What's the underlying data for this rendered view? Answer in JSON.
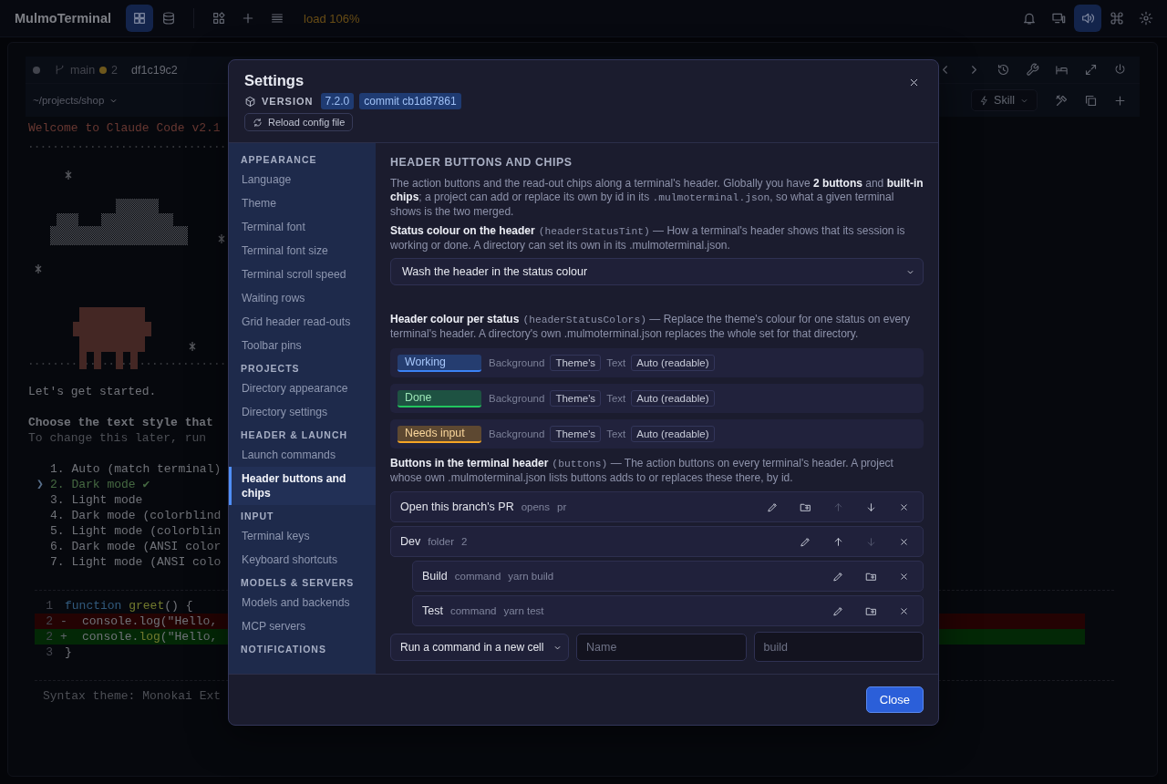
{
  "app": {
    "title": "MulmoTerminal",
    "load": "load 106%",
    "left_tools": [
      {
        "selected": true
      },
      {
        "selected": false
      },
      {
        "selected": false
      },
      {
        "selected": false
      },
      {
        "selected": false
      }
    ],
    "right_tools": [
      {
        "selected": false
      },
      {
        "selected": false
      },
      {
        "selected": true
      },
      {
        "selected": false
      },
      {
        "selected": false
      }
    ]
  },
  "terminal": {
    "branch": "main",
    "changes": "2",
    "commit": "df1c19c2",
    "path": "~/projects/shop",
    "skill": "Skill",
    "welcome": "Welcome to Claude Code v2.1",
    "intro": "Let's get started.",
    "prompt": "Choose the text style that",
    "hint": "To change this later, run",
    "theme_menu": {
      "pointer": "❯",
      "options": [
        {
          "label": "1. Auto (match terminal)",
          "selected": false
        },
        {
          "label": "2. Dark mode ✔",
          "selected": true
        },
        {
          "label": "3. Light mode",
          "selected": false
        },
        {
          "label": "4. Dark mode (colorblind",
          "selected": false
        },
        {
          "label": "5. Light mode (colorblin",
          "selected": false
        },
        {
          "label": "6. Dark mode (ANSI color",
          "selected": false
        },
        {
          "label": "7. Light mode (ANSI colo",
          "selected": false
        }
      ]
    },
    "diff": [
      {
        "kind": "context",
        "number": "1",
        "tokens": [
          {
            "kind": "keyword",
            "text": "function "
          },
          {
            "kind": "function",
            "text": "greet"
          },
          {
            "kind": "plain",
            "text": "() {"
          }
        ]
      },
      {
        "kind": "removed",
        "number": "2",
        "sign": "-",
        "tokens": [
          {
            "kind": "plain",
            "text": "console.log(\"Hello,"
          }
        ]
      },
      {
        "kind": "added",
        "number": "2",
        "sign": "+",
        "tokens": [
          {
            "kind": "plain",
            "text": "console."
          },
          {
            "kind": "function",
            "text": "log"
          },
          {
            "kind": "plain",
            "text": "(\"Hello,"
          }
        ]
      },
      {
        "kind": "context",
        "number": "3",
        "tokens": [
          {
            "kind": "plain",
            "text": "}"
          }
        ]
      }
    ],
    "syntax_note": "Syntax theme: Monokai Ext"
  },
  "settings": {
    "title": "Settings",
    "version_label": "VERSION",
    "version": "7.2.0",
    "commit": "commit cb1d87861",
    "reload": "Reload config file",
    "sidebar": [
      {
        "heading": "APPEARANCE",
        "items": [
          {
            "label": "Language",
            "selected": false
          },
          {
            "label": "Theme",
            "selected": false
          },
          {
            "label": "Terminal font",
            "selected": false
          },
          {
            "label": "Terminal font size",
            "selected": false
          },
          {
            "label": "Terminal scroll speed",
            "selected": false
          },
          {
            "label": "Waiting rows",
            "selected": false
          },
          {
            "label": "Grid header read-outs",
            "selected": false
          },
          {
            "label": "Toolbar pins",
            "selected": false
          }
        ]
      },
      {
        "heading": "PROJECTS",
        "items": [
          {
            "label": "Directory appearance",
            "selected": false
          },
          {
            "label": "Directory settings",
            "selected": false
          }
        ]
      },
      {
        "heading": "HEADER & LAUNCH",
        "items": [
          {
            "label": "Launch commands",
            "selected": false
          },
          {
            "label": "Header buttons and chips",
            "selected": true
          }
        ]
      },
      {
        "heading": "INPUT",
        "items": [
          {
            "label": "Terminal keys",
            "selected": false
          },
          {
            "label": "Keyboard shortcuts",
            "selected": false
          }
        ]
      },
      {
        "heading": "MODELS & SERVERS",
        "items": [
          {
            "label": "Models and backends",
            "selected": false
          },
          {
            "label": "MCP servers",
            "selected": false
          }
        ]
      },
      {
        "heading": "NOTIFICATIONS"
      }
    ],
    "heading": "HEADER BUTTONS AND CHIPS",
    "intro": [
      {
        "kind": "plain",
        "text": "The action buttons and the read-out chips along a terminal's header. Globally you have "
      },
      {
        "kind": "bold",
        "text": "2 buttons"
      },
      {
        "kind": "plain",
        "text": " and "
      },
      {
        "kind": "bold",
        "text": "built-in chips"
      },
      {
        "kind": "plain",
        "text": "; a project can add or replace its own by id in its "
      },
      {
        "kind": "code",
        "text": ".mulmoterminal.json"
      },
      {
        "kind": "plain",
        "text": ", so what a given terminal shows is the two merged."
      }
    ],
    "tint": {
      "description": [
        {
          "kind": "bold",
          "text": "Status colour on the header"
        },
        {
          "kind": "code",
          "text": "(headerStatusTint)"
        },
        {
          "kind": "plain",
          "text": " — How a terminal's header shows that its session is working or done. A directory can set its own in its .mulmoterminal.json."
        }
      ],
      "value": "Wash the header in the status colour"
    },
    "status_colors": {
      "description": [
        {
          "kind": "bold",
          "text": "Header colour per status"
        },
        {
          "kind": "code",
          "text": "(headerStatusColors)"
        },
        {
          "kind": "plain",
          "text": " — Replace the theme's colour for one status on every terminal's header. A directory's own .mulmoterminal.json replaces the whole set for that directory."
        }
      ],
      "rows": [
        {
          "status": "Working",
          "color": "#3b82f6",
          "background_label": "Background",
          "background": "Theme's",
          "text_label": "Text",
          "text": "Auto (readable)"
        },
        {
          "status": "Done",
          "color": "#22c55e",
          "background_label": "Background",
          "background": "Theme's",
          "text_label": "Text",
          "text": "Auto (readable)"
        },
        {
          "status": "Needs input",
          "color": "#f5a524",
          "background_label": "Background",
          "background": "Theme's",
          "text_label": "Text",
          "text": "Auto (readable)"
        }
      ]
    },
    "buttons": {
      "description": [
        {
          "kind": "bold",
          "text": "Buttons in the terminal header"
        },
        {
          "kind": "code",
          "text": "(buttons)"
        },
        {
          "kind": "plain",
          "text": " — The action buttons on every terminal's header. A project whose own .mulmoterminal.json lists buttons adds to or replaces these there, by id."
        }
      ],
      "items": [
        {
          "name": "Open this branch's PR",
          "type_label": "opens",
          "detail": "pr",
          "actions": [
            {
              "kind": "edit",
              "disabled": false
            },
            {
              "kind": "folder",
              "disabled": false
            },
            {
              "kind": "up",
              "disabled": true
            },
            {
              "kind": "down",
              "disabled": false
            },
            {
              "kind": "remove",
              "disabled": false
            }
          ]
        },
        {
          "name": "Dev",
          "type_label": "folder",
          "detail": "2",
          "actions": [
            {
              "kind": "edit",
              "disabled": false
            },
            {
              "kind": "up",
              "disabled": false
            },
            {
              "kind": "down",
              "disabled": true
            },
            {
              "kind": "remove",
              "disabled": false
            }
          ],
          "children": [
            {
              "name": "Build",
              "type_label": "command",
              "detail": "yarn build",
              "actions": [
                {
                  "kind": "edit",
                  "disabled": false
                },
                {
                  "kind": "folder",
                  "disabled": false
                },
                {
                  "kind": "remove",
                  "disabled": false
                }
              ]
            },
            {
              "name": "Test",
              "type_label": "command",
              "detail": "yarn test",
              "actions": [
                {
                  "kind": "edit",
                  "disabled": false
                },
                {
                  "kind": "folder",
                  "disabled": false
                },
                {
                  "kind": "remove",
                  "disabled": false
                }
              ]
            }
          ]
        }
      ],
      "add": {
        "action": "Run a command in a new cell",
        "name_placeholder": "Name",
        "command_placeholder": "build"
      }
    },
    "close": "Close"
  }
}
